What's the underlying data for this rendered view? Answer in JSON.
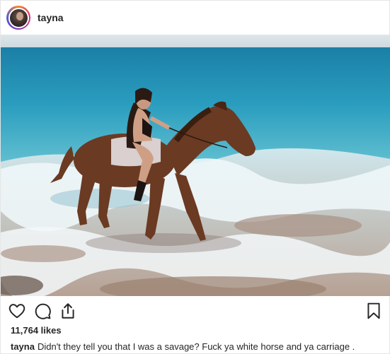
{
  "post": {
    "username": "tayna",
    "likes": "11,764 likes",
    "caption_user": "tayna",
    "caption_text": "Didn't they tell you that I was a savage? Fuck ya white horse and ya carriage ."
  },
  "icons": {
    "avatar": "profile-avatar",
    "like": "heart-icon",
    "comment": "comment-bubble-icon",
    "share": "share-upload-icon",
    "save": "bookmark-icon"
  },
  "colors": {
    "text": "#262626",
    "sea_deep": "#1f8fb0",
    "sea_shallow": "#5fc0d4",
    "foam": "#eef6f8",
    "sand": "#a68a78",
    "horse": "#6b3a22"
  }
}
